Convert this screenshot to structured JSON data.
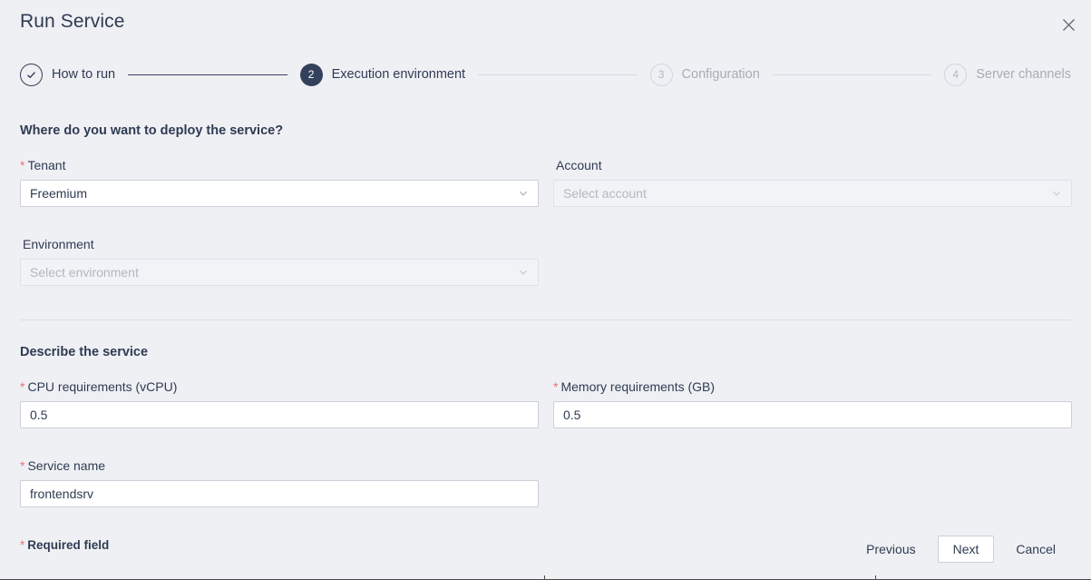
{
  "header": {
    "title": "Run Service",
    "close_icon": "close-icon"
  },
  "stepper": {
    "steps": [
      {
        "number": "1",
        "label": "How to run",
        "state": "done",
        "marker": "check-icon"
      },
      {
        "number": "2",
        "label": "Execution environment",
        "state": "current",
        "marker": "2"
      },
      {
        "number": "3",
        "label": "Configuration",
        "state": "pending",
        "marker": "3"
      },
      {
        "number": "4",
        "label": "Server channels",
        "state": "pending",
        "marker": "4"
      }
    ]
  },
  "sections": {
    "deploy": {
      "heading": "Where do you want to deploy the service?",
      "fields": {
        "tenant": {
          "label": "Tenant",
          "required": "*",
          "value": "Freemium",
          "icon": "chevron-down-icon"
        },
        "account": {
          "label": "Account",
          "required": "",
          "placeholder": "Select account",
          "icon": "chevron-down-icon"
        },
        "environment": {
          "label": "Environment",
          "required": "",
          "placeholder": "Select environment",
          "icon": "chevron-down-icon"
        }
      }
    },
    "describe": {
      "heading": "Describe the service",
      "fields": {
        "cpu": {
          "label": "CPU requirements (vCPU)",
          "required": "*",
          "value": "0.5"
        },
        "memory": {
          "label": "Memory requirements (GB)",
          "required": "*",
          "value": "0.5"
        },
        "service_name": {
          "label": "Service name",
          "required": "*",
          "value": "frontendsrv"
        }
      }
    }
  },
  "footer": {
    "required_star": "*",
    "required_note": "Required field",
    "previous_label": "Previous",
    "next_label": "Next",
    "cancel_label": "Cancel"
  },
  "colors": {
    "page_background": "#eff0f4",
    "accent_dark": "#33415c",
    "required_red": "#e8737f",
    "muted_gray": "#a9acb7",
    "border": "#cdd0d9"
  }
}
